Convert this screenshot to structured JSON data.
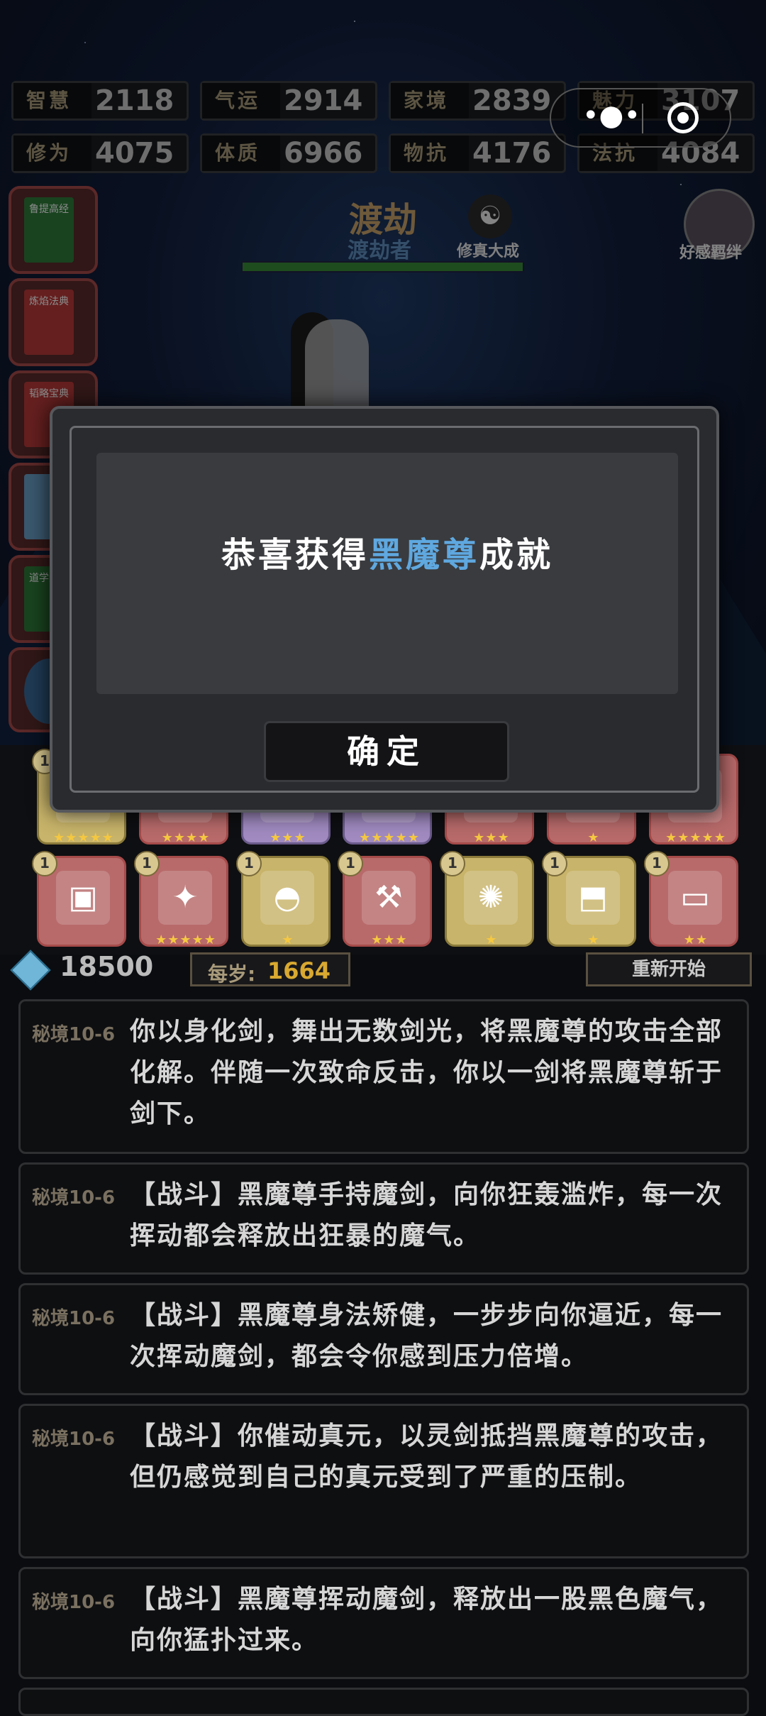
{
  "stats": [
    {
      "label": "智慧",
      "value": "2118"
    },
    {
      "label": "气运",
      "value": "2914"
    },
    {
      "label": "家境",
      "value": "2839"
    },
    {
      "label": "魅力",
      "value": "3107"
    },
    {
      "label": "修为",
      "value": "4075"
    },
    {
      "label": "体质",
      "value": "6966"
    },
    {
      "label": "物抗",
      "value": "4176"
    },
    {
      "label": "法抗",
      "value": "4084"
    }
  ],
  "capsule": {
    "more_icon": "more-dots-icon",
    "close_icon": "target-icon"
  },
  "books": [
    {
      "title": "鲁提高经",
      "color": "#2e7a3a"
    },
    {
      "title": "炼焰法典",
      "color": "#b83a3a"
    },
    {
      "title": "韬略宝典",
      "color": "#b83a3a"
    },
    {
      "title": "",
      "color": "#6aa0c8"
    },
    {
      "title": "道学大典",
      "color": "#2e7a3a"
    }
  ],
  "realm": {
    "title": "渡劫",
    "subtitle": "渡劫者",
    "stage": "修真大成",
    "progress": 1.0
  },
  "favor": {
    "label": "好感羁绊"
  },
  "items_row1": [
    {
      "level": "1",
      "stars": 5,
      "style": "gold",
      "icon": "orb-icon"
    },
    {
      "level": "",
      "stars": 4,
      "style": "red",
      "icon": "fruit-icon"
    },
    {
      "level": "",
      "stars": 3,
      "style": "purple",
      "icon": "blade-icon"
    },
    {
      "level": "",
      "stars": 5,
      "style": "purple",
      "icon": "leaf-icon"
    },
    {
      "level": "",
      "stars": 3,
      "style": "red",
      "icon": "beast-icon"
    },
    {
      "level": "",
      "stars": 1,
      "style": "red",
      "icon": "sword-icon"
    },
    {
      "level": "",
      "stars": 5,
      "style": "red",
      "icon": "spear-icon"
    }
  ],
  "items_row2": [
    {
      "level": "1",
      "stars": 0,
      "style": "red",
      "icon": "seal-icon"
    },
    {
      "level": "1",
      "stars": 5,
      "style": "red",
      "icon": "dagger-icon"
    },
    {
      "level": "1",
      "stars": 1,
      "style": "gold",
      "icon": "fan-icon"
    },
    {
      "level": "1",
      "stars": 3,
      "style": "red",
      "icon": "axe-icon"
    },
    {
      "level": "1",
      "stars": 1,
      "style": "gold",
      "icon": "scepter-icon"
    },
    {
      "level": "1",
      "stars": 1,
      "style": "gold",
      "icon": "boots-icon"
    },
    {
      "level": "1",
      "stars": 2,
      "style": "red",
      "icon": "scroll-icon"
    }
  ],
  "resources": {
    "gems": "18500",
    "age_label": "每岁:",
    "age_value": "1664",
    "restart_label": "重新开始"
  },
  "log": [
    {
      "tag": "秘境10-6",
      "text": "你以身化剑，舞出无数剑光，将黑魔尊的攻击全部化解。伴随一次致命反击，你以一剑将黑魔尊斩于剑下。"
    },
    {
      "tag": "秘境10-6",
      "text": "【战斗】黑魔尊手持魔剑，向你狂轰滥炸，每一次挥动都会释放出狂暴的魔气。"
    },
    {
      "tag": "秘境10-6",
      "text": "【战斗】黑魔尊身法矫健，一步步向你逼近，每一次挥动魔剑，都会令你感到压力倍增。"
    },
    {
      "tag": "秘境10-6",
      "text": "【战斗】你催动真元，以灵剑抵挡黑魔尊的攻击，但仍感觉到自己的真元受到了严重的压制。"
    },
    {
      "tag": "秘境10-6",
      "text": "【战斗】黑魔尊挥动魔剑，释放出一股黑色魔气，向你猛扑过来。"
    }
  ],
  "modal": {
    "prefix": "恭喜获得",
    "highlight": "黑魔尊",
    "suffix": "成就",
    "confirm_label": "确定",
    "highlight_color": "#5fa8e0"
  }
}
